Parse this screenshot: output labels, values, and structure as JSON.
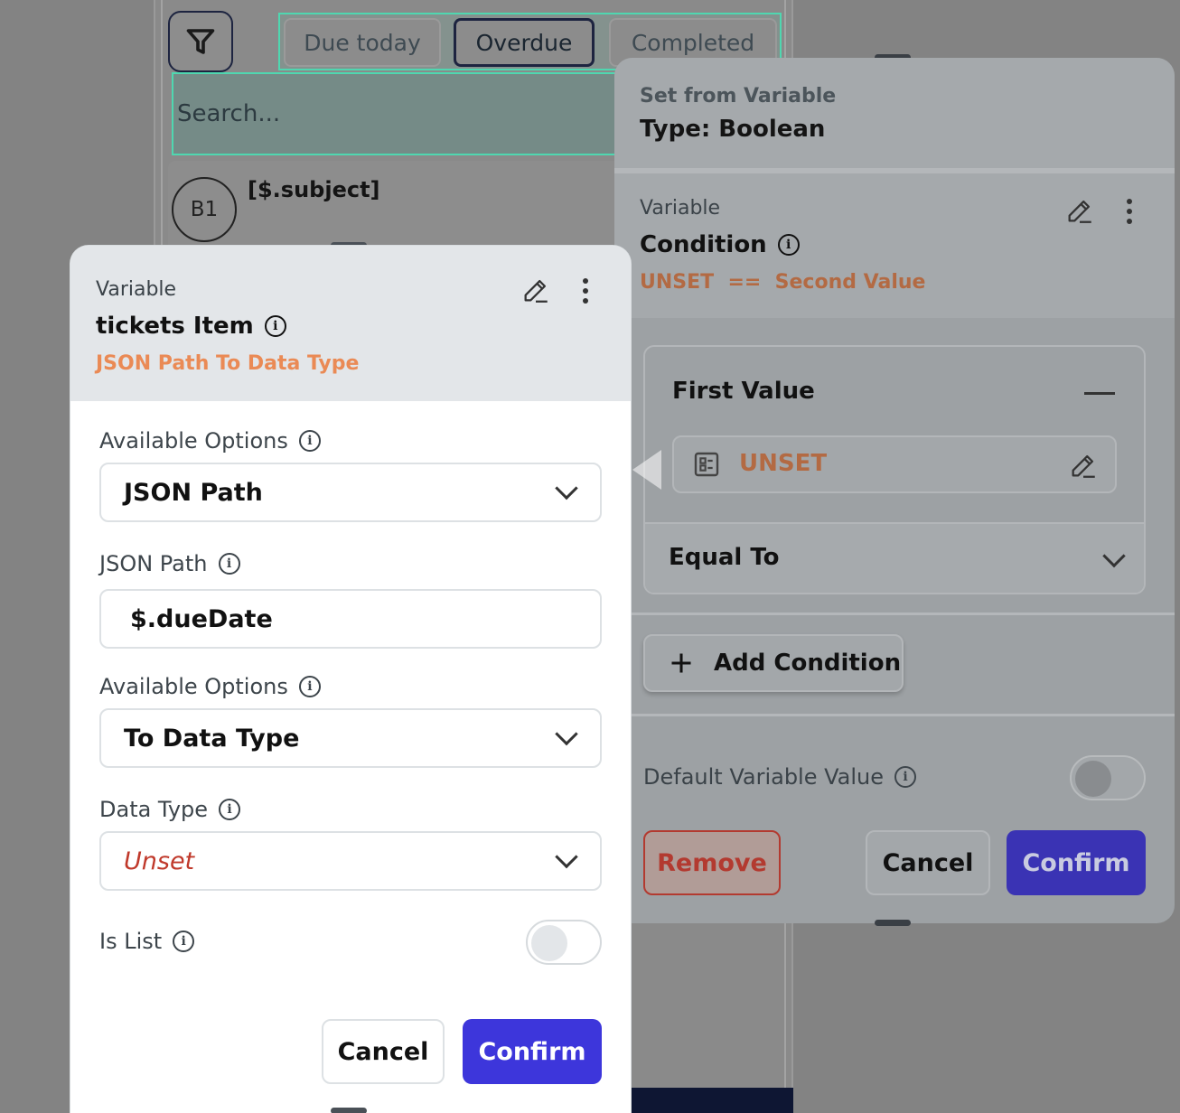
{
  "background": {
    "filter_icon": "filter-icon",
    "chips": [
      "Due today",
      "Overdue",
      "Completed"
    ],
    "search_placeholder": "Search...",
    "row": {
      "avatar": "B1",
      "title": "[$.subject]"
    }
  },
  "right_modal": {
    "header_label": "Set from Variable",
    "header_type": "Type: Boolean",
    "variable_label": "Variable",
    "variable_title": "Condition",
    "expression": "UNSET  ==  Second Value",
    "first_value_label": "First Value",
    "first_value": "UNSET",
    "operator": "Equal To",
    "add_condition": "Add Condition",
    "default_label": "Default Variable Value",
    "remove": "Remove",
    "cancel": "Cancel",
    "confirm": "Confirm"
  },
  "left_modal": {
    "variable_label": "Variable",
    "title": "tickets Item",
    "subtitle": "JSON Path To Data Type",
    "options_label_1": "Available Options",
    "option_1": "JSON Path",
    "json_path_label": "JSON Path",
    "json_path_value": "$.dueDate",
    "options_label_2": "Available Options",
    "option_2": "To Data Type",
    "data_type_label": "Data Type",
    "data_type_value": "Unset",
    "is_list_label": "Is List",
    "cancel": "Cancel",
    "confirm": "Confirm"
  },
  "colors": {
    "accent": "#3d36db",
    "orange": "#ea8a55",
    "unset_red": "#c0392b",
    "remove_red": "#b33a30"
  }
}
